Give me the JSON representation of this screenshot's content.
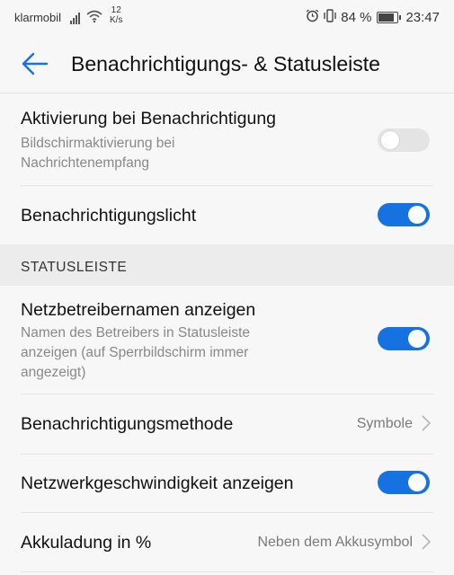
{
  "statusbar": {
    "carrier": "klarmobil",
    "speed_value": "12",
    "speed_unit": "K/s",
    "battery_level": 0.84,
    "battery": "84 %",
    "time": "23:47",
    "icons": [
      "signal-icon",
      "wifi-icon",
      "alarm-icon",
      "vibrate-icon",
      "battery-icon"
    ]
  },
  "header": {
    "title": "Benachrichtigungs- & Statusleiste",
    "back_icon": "back-arrow-icon"
  },
  "colors": {
    "accent": "#1672e0",
    "toggle_off": "#e4e4e4",
    "section_bg": "#ececec",
    "background": "#f7f7f7"
  },
  "settings": [
    {
      "label": "Aktivierung bei Benachrichtigung",
      "sub1": "Bildschirmaktivierung bei",
      "sub2": "Nachrichtenempfang",
      "toggle": false
    },
    {
      "label": "Benachrichtigungslicht",
      "toggle": true
    }
  ],
  "section": {
    "label": "STATUSLEISTE"
  },
  "status_settings": [
    {
      "label": "Netzbetreibernamen anzeigen",
      "sub1": "Namen des Betreibers in Statusleiste",
      "sub2": "anzeigen (auf Sperrbildschirm immer",
      "sub3": "angezeigt)",
      "toggle": true
    },
    {
      "label": "Benachrichtigungsmethode",
      "value": "Symbole"
    },
    {
      "label": "Netzwerkgeschwindigkeit anzeigen",
      "toggle": true
    },
    {
      "label": "Akkuladung in %",
      "value": "Neben dem Akkusymbol"
    }
  ]
}
